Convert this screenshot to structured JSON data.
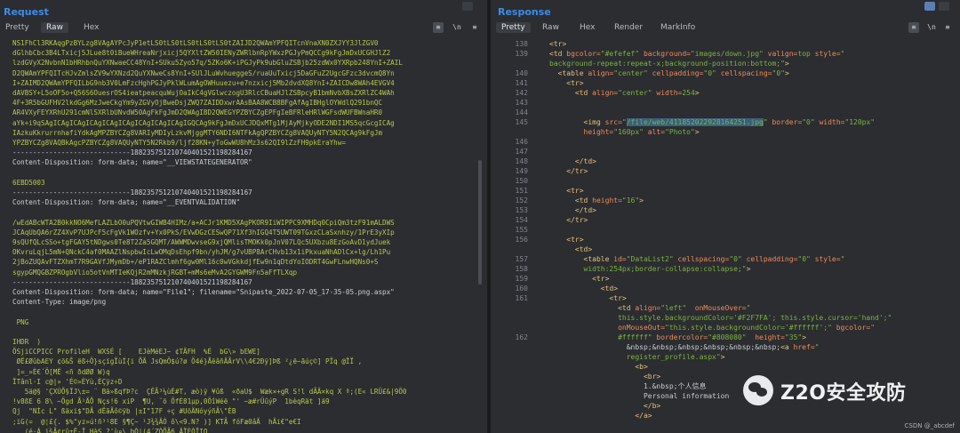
{
  "request": {
    "title": "Request",
    "tabs": [
      "Pretty",
      "Raw",
      "Hex"
    ],
    "active_tab": "Raw",
    "ln_label": "\\n",
    "lines": [
      "NS1FhCl3RKAqgPzBYLzg8VAgAYPcJyP1etLS0tLS0tLS0tLS0tLS0tZAIJD2QWAmYPFQITcnVnaXN0ZXJYY3JlZGV0",
      "dGlhbCbc3B4LTxicj5JLue8t0iBueWHreaNrjxicj5QYXltZW50IENyZWRlbnRpYWxzPGJyPmQCCg9kFgJmDxUCGHJlZ2",
      "lzdGVyX2NvbnN1bHRhbnQuYXNwaeCC48YnI+SUku5Zyo57q/5ZKo6K+iPGJyPk9ubGluZSBjb25zdWx0YXRpb248YnI+ZAIL",
      "D2QWAmYPFQITcHJvZmlsZV9wYXNzd2QuYXNweCs8YnI+SUlJLuWvhueggeS/ruaUuTxicj5DaGFuZ2UgcGFzc3dvcmQ8Yn",
      "I+ZAIMD2QWAmYPFQILbG9nb3V0LmFzcHghPGJyPklWLumAgOWHuuezu+e7nzxicj5Mb2dvdXQ8YnI+ZAICDw8WAh4EVGV4",
      "dAVBSY+L5oOF5o+Q56S6OuesrOS4ieatpeacquWujOaIkC4gVGlwczogU3RlcCBuaHJlZSBpcyB1bmNvbXBsZXRlZC4WAh",
      "4F+3R5bGUFHV2lkdGg6MzJweCkgYm9yZGVyOjBweDsjZWQ7ZAIDDxwrAAsBAA8WCB8BFgAfAgIBHglOYWdlQ291bnQC",
      "AR4VXyFEYXRhU291cmNlSXRlbUNvdW50AgFkFgJmD2QWAgIBD2QWEGYPZBYCZgEPFgIeBFRleHRlWGFsdWUFBWnaHR0",
      "aYk+i9qSAgICAgICAgICAgICAgICAgICAgICAgICAgIGQCAg9kFgJmDxUCJDQxMTg1MjAyMjkyODE2NDI1MS5qcGcgICAg",
      "IAzkuKkrurrnhafiYdkAgMPZBYCZg8VARIyMDIyLzkvMjggMTY6NDI6NTFkAgQPZBYCZg8VAQUyNTY5N2QCAg9kFgJm",
      "YPZBYCZg8VAQBkAgcPZBYCZg8VAQUyNTY5N2Rkb9/ljf28KN+yToGwWU8hMz3s62QI9lZzFH9pkEraYhw=",
      "-----------------------------188235751210740401521198284167",
      "Content-Disposition: form-data; name=\"__VIEWSTATEGENERATOR\"",
      "",
      "6EBD5003",
      "-----------------------------188235751210740401521198284167",
      "Content-Disposition: form-data; name=\"__EVENTVALIDATION\"",
      "",
      "/wEdABcWTA2B0kkNO6MefLAZLbO0uPQVtwGIWB4HIMz/a+ACJr1KMD5XAgPKOR9IiWIPPC9XMHDq0CpiQm3tzF91mALDWS",
      "JCAqUbQA6rZZ4XvP7UJPcF5cFgVk1WOzfv+Yx0PkS/EVwDGzCESwQP71Xf3hIGQ4T5UWT09TGxzCLaSxnhzy/1PrE3yXIp",
      "9sQUfQLcSSo+tgFGAY5tNDgws0Te8T2Za5GQMT/AWWMDwvseG9xjQMlisTMOKk0pJnV07LQc5UXbzu8EzGoAvD1ydJuek",
      "OKvruLqjL5mN+QNckC4af0MAAZlNspbwIcLwOMqDsEhpf9bn/yhJM/g7vUBP8ArCHvb13x1iPkxuaNhADlCx+lg/Lh1Pu",
      "2jBoZUQAvFTZXhmT7R9GAVfJMymDb+/eP1RAZClmhf6gw0Ml16c0wVGkkdjfEw9n1qDtdYoIODRT4GwFLnwHQNs0+S",
      "sgypGMQGBZPROgbVlio5otVnMTIeKQjR2mMNzkjRGBT+mMs6eMvA2GYGWM9Fn5aFfTLXqp",
      "-----------------------------188235751210740401521198284167",
      "Content-Disposition: form-data; name=\"File1\"; filename=\"Snipaste_2022-07-05_17-35-05.png.aspx\"",
      "Content-Type: image/png",
      "",
      " PNG",
      "",
      "IHDR  )",
      "ÖSjiCCPICC ProfileH  WXSÉ [    EJèMéEJ~ ¢TÄFH  %É  bG\\» bEWE]",
      " ØË£ØûbAEY ¢ö&Š ëß÷Ö}sçïgÏùÍ{i ÕÄ JsQmÖ$ú?ø Ö4é}ÅëâñÄÃrV\\\\4€2Ðÿ]Þß ²¿ë~ãúç©] PÏq @ÏÏ ,",
      " ]=_»È€´Ö[MË «ñ ðdØØ W)q",
      "ÏTânl·I c@|» 'É©»ÈYù,ÈÇÿz÷D",
      "   5ä@§ 'ÇXÙÕ§ÏJ\\±= ¨ Bä»ßqfÞ?c  ÇÊÃ³¼ùÉ#T, æò)ÿ ¥ûß  «ðaU$  Wæk×+gR S!l dÃÄ×kq X ª;(E« LRÜ£&|9Ö0",
      "!v8ßE 6 8\\ ~Ögd Ã¹ÄÕ Nçs!6 xiP  ¶U, ¨ö ÖfÉ81µp,0ÖîWéë \"' ~æ#rÜûýP  1bèqRät ]ä9",
      "Qj  \"NÌc L\" ßäxi$\"DÃ dËãÃô©ÿb |±I\"17F ÷ç #UõÄNóyýñÂ\\\"ÉB",
      ";iG(=  @¦£{. $%\"yz»ú!ñ³¹8E §¶Ç~ ¹J¾¾ÄÓ ô\\<9.N? )] KTÃ fóFæ0âÄ  hÄi€\"e€I",
      "   (é·Á i¾Ã¢rû±Ë-Ï HàS ?'ù¤\\ bÒ|(4´ZÒÕÃ6 ÄÏÈÒÏIO"
    ]
  },
  "response": {
    "title": "Response",
    "tabs": [
      "Pretty",
      "Raw",
      "Hex",
      "Render",
      "MarkInfo"
    ],
    "active_tab": "Pretty",
    "ln_label": "\\n",
    "line_numbers": [
      "138",
      "139",
      "",
      "140",
      "141",
      "142",
      "143",
      "144",
      "145",
      "",
      "146",
      "147",
      "148",
      "149",
      "150",
      "151",
      "152",
      "153",
      "154",
      "155",
      "156",
      "",
      "157",
      "158",
      "159",
      "160",
      "161",
      "",
      "",
      "",
      "162",
      "",
      "",
      "",
      "",
      ""
    ],
    "lines": [
      [
        {
          "t": "<tr>",
          "c": "tg"
        }
      ],
      [
        {
          "t": "<td ",
          "c": "tg"
        },
        {
          "t": "bgcolor=",
          "c": "at"
        },
        {
          "t": "\"#efefef\"",
          "c": "av"
        },
        {
          "t": " background=",
          "c": "at"
        },
        {
          "t": "\"images/down.jpg\"",
          "c": "av"
        },
        {
          "t": " valign=",
          "c": "at"
        },
        {
          "t": "top",
          "c": "av"
        },
        {
          "t": " style=",
          "c": "at"
        },
        {
          "t": "\"",
          "c": "av"
        }
      ],
      [
        {
          "t": "background-repeat:repeat-x;background-position:bottom;\"",
          "c": "av"
        },
        {
          "t": ">",
          "c": "tg"
        }
      ],
      [
        {
          "t": "  <table ",
          "c": "tg"
        },
        {
          "t": "align=",
          "c": "at"
        },
        {
          "t": "\"center\"",
          "c": "av"
        },
        {
          "t": " cellpadding=",
          "c": "at"
        },
        {
          "t": "\"0\"",
          "c": "av"
        },
        {
          "t": " cellspacing=",
          "c": "at"
        },
        {
          "t": "\"0\"",
          "c": "av"
        },
        {
          "t": ">",
          "c": "tg"
        }
      ],
      [
        {
          "t": "    <tr>",
          "c": "tg"
        }
      ],
      [
        {
          "t": "      <td ",
          "c": "tg"
        },
        {
          "t": "align=",
          "c": "at"
        },
        {
          "t": "\"center\"",
          "c": "av"
        },
        {
          "t": " width=",
          "c": "at"
        },
        {
          "t": "254",
          "c": "av"
        },
        {
          "t": ">",
          "c": "tg"
        }
      ],
      [
        {
          "t": "",
          "c": ""
        }
      ],
      [
        {
          "t": "",
          "c": ""
        }
      ],
      [
        {
          "t": "        <img ",
          "c": "tg"
        },
        {
          "t": "src=",
          "c": "at"
        },
        {
          "t": "\"",
          "c": "av"
        },
        {
          "t": "/file/web/411852022928164251.jpg",
          "c": "av hl"
        },
        {
          "t": "\"",
          "c": "av"
        },
        {
          "t": " border=",
          "c": "at"
        },
        {
          "t": "\"0\"",
          "c": "av"
        },
        {
          "t": " width=",
          "c": "at"
        },
        {
          "t": "\"120px\"",
          "c": "av"
        }
      ],
      [
        {
          "t": "        height=",
          "c": "at"
        },
        {
          "t": "\"160px\"",
          "c": "av"
        },
        {
          "t": " alt=",
          "c": "at"
        },
        {
          "t": "\"Photo\"",
          "c": "av"
        },
        {
          "t": ">",
          "c": "tg"
        }
      ],
      [
        {
          "t": "",
          "c": ""
        }
      ],
      [
        {
          "t": "",
          "c": ""
        }
      ],
      [
        {
          "t": "      </td>",
          "c": "tg"
        }
      ],
      [
        {
          "t": "    </tr>",
          "c": "tg"
        }
      ],
      [
        {
          "t": "",
          "c": ""
        }
      ],
      [
        {
          "t": "    <tr>",
          "c": "tg"
        }
      ],
      [
        {
          "t": "      <td ",
          "c": "tg"
        },
        {
          "t": "height=",
          "c": "at"
        },
        {
          "t": "\"16\"",
          "c": "av"
        },
        {
          "t": ">",
          "c": "tg"
        }
      ],
      [
        {
          "t": "      </td>",
          "c": "tg"
        }
      ],
      [
        {
          "t": "    </tr>",
          "c": "tg"
        }
      ],
      [
        {
          "t": "",
          "c": ""
        }
      ],
      [
        {
          "t": "    <tr>",
          "c": "tg"
        }
      ],
      [
        {
          "t": "      <td>",
          "c": "tg"
        }
      ],
      [
        {
          "t": "        <table ",
          "c": "tg"
        },
        {
          "t": "id=",
          "c": "at"
        },
        {
          "t": "\"DataList2\"",
          "c": "av"
        },
        {
          "t": " cellspacing=",
          "c": "at"
        },
        {
          "t": "\"0\"",
          "c": "av"
        },
        {
          "t": " cellpadding=",
          "c": "at"
        },
        {
          "t": "\"0\"",
          "c": "av"
        },
        {
          "t": " style=",
          "c": "at"
        },
        {
          "t": "\"",
          "c": "av"
        }
      ],
      [
        {
          "t": "        width:254px;border-collapse:collapse;\"",
          "c": "av"
        },
        {
          "t": ">",
          "c": "tg"
        }
      ],
      [
        {
          "t": "          <tr>",
          "c": "tg"
        }
      ],
      [
        {
          "t": "            <td>",
          "c": "tg"
        }
      ],
      [
        {
          "t": "              <tr>",
          "c": "tg"
        }
      ],
      [
        {
          "t": "                <td ",
          "c": "tg"
        },
        {
          "t": "align=",
          "c": "at"
        },
        {
          "t": "\"left\"",
          "c": "av"
        },
        {
          "t": "  onMouseOver=",
          "c": "at"
        },
        {
          "t": "\"",
          "c": "av"
        }
      ],
      [
        {
          "t": "                this.style.backgroundColor='#F2F7FA'; this.style.cursor='hand';\"",
          "c": "av"
        }
      ],
      [
        {
          "t": "                onMouseOut=",
          "c": "at"
        },
        {
          "t": "\"this.style.backgroundColor='#ffffff';\"",
          "c": "av"
        },
        {
          "t": " bgcolor=",
          "c": "at"
        },
        {
          "t": "\"",
          "c": "av"
        }
      ],
      [
        {
          "t": "                #ffffff\"",
          "c": "av"
        },
        {
          "t": " bordercolor=",
          "c": "at"
        },
        {
          "t": "\"#808080\"",
          "c": "av"
        },
        {
          "t": "  height=",
          "c": "at"
        },
        {
          "t": "\"35\"",
          "c": "av"
        },
        {
          "t": ">",
          "c": "tg"
        }
      ],
      [
        {
          "t": "                  &nbsp;&nbsp;&nbsp;&nbsp;&nbsp;&nbsp;",
          "c": ""
        },
        {
          "t": "<a ",
          "c": "tg"
        },
        {
          "t": "href=",
          "c": "at"
        },
        {
          "t": "\"",
          "c": "av"
        }
      ],
      [
        {
          "t": "                  register_profile.aspx\"",
          "c": "av"
        },
        {
          "t": ">",
          "c": "tg"
        }
      ],
      [
        {
          "t": "                    <b>",
          "c": "tg"
        }
      ],
      [
        {
          "t": "                      <br>",
          "c": "tg"
        }
      ],
      [
        {
          "t": "                      1.&nbsp;个人信息",
          "c": ""
        }
      ],
      [
        {
          "t": "                      Personal information",
          "c": ""
        }
      ],
      [
        {
          "t": "                      </b>",
          "c": "tg"
        }
      ],
      [
        {
          "t": "                    </a>",
          "c": "tg"
        }
      ]
    ]
  },
  "watermark": {
    "text": "Z2O安全攻防",
    "icon": "wechat-icon"
  },
  "csdn": "CSDN @_abcdef"
}
